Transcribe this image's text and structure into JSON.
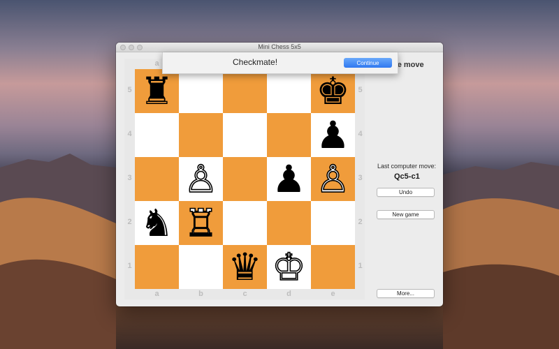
{
  "window": {
    "title": "Mini Chess 5x5"
  },
  "sheet": {
    "message": "Checkmate!",
    "continue_label": "Continue"
  },
  "panel": {
    "header_fragment": "ite move",
    "last_move_label": "Last computer move:",
    "last_move_value": "Qc5-c1",
    "undo_label": "Undo",
    "new_game_label": "New game",
    "more_label": "More..."
  },
  "board": {
    "files": [
      "a",
      "b",
      "c",
      "d",
      "e"
    ],
    "ranks": [
      "5",
      "4",
      "3",
      "2",
      "1"
    ],
    "pieces": [
      {
        "square": "a5",
        "color": "black",
        "type": "rook",
        "glyph": "♜"
      },
      {
        "square": "e5",
        "color": "black",
        "type": "king",
        "glyph": "♚"
      },
      {
        "square": "e4",
        "color": "black",
        "type": "pawn",
        "glyph": "♟"
      },
      {
        "square": "b3",
        "color": "white",
        "type": "pawn",
        "glyph": "♙"
      },
      {
        "square": "d3",
        "color": "black",
        "type": "pawn",
        "glyph": "♟"
      },
      {
        "square": "e3",
        "color": "white",
        "type": "pawn",
        "glyph": "♙"
      },
      {
        "square": "a2",
        "color": "black",
        "type": "knight",
        "glyph": "♞"
      },
      {
        "square": "b2",
        "color": "white",
        "type": "rook",
        "glyph": "♖"
      },
      {
        "square": "c1",
        "color": "black",
        "type": "queen",
        "glyph": "♛"
      },
      {
        "square": "d1",
        "color": "white",
        "type": "king",
        "glyph": "♔"
      }
    ]
  }
}
